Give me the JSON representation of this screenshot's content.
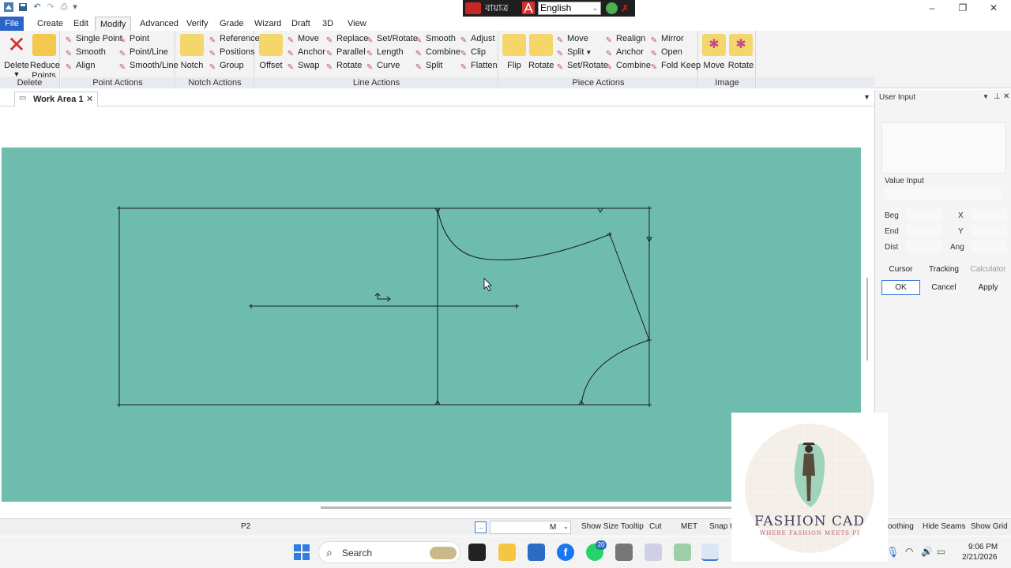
{
  "language": {
    "input_lang": "বায়াত্র",
    "selected": "English"
  },
  "menu": {
    "tabs": [
      {
        "label": "File"
      },
      {
        "label": "Create"
      },
      {
        "label": "Edit"
      },
      {
        "label": "Modify"
      },
      {
        "label": "Advanced"
      },
      {
        "label": "Verify"
      },
      {
        "label": "Grade"
      },
      {
        "label": "Wizard"
      },
      {
        "label": "Draft"
      },
      {
        "label": "3D"
      },
      {
        "label": "View"
      }
    ],
    "active": "Modify"
  },
  "ribbon": {
    "delete": {
      "label": "Delete",
      "buttons": [
        "Delete",
        "Reduce Points"
      ]
    },
    "point_actions": {
      "label": "Point Actions",
      "buttons": [
        "Single Point",
        "Point",
        "Smooth",
        "Point/Line",
        "Align",
        "Smooth/Line"
      ]
    },
    "notch_actions": {
      "label": "Notch Actions",
      "buttons": [
        "Notch",
        "Reference",
        "Positions",
        "Group"
      ]
    },
    "line_actions": {
      "label": "Line Actions",
      "buttons": [
        "Offset",
        "Move",
        "Anchor",
        "Swap",
        "Replace",
        "Parallel",
        "Rotate",
        "Set/Rotate",
        "Length",
        "Curve",
        "Smooth",
        "Combine",
        "Split",
        "Adjust",
        "Clip",
        "Flatten"
      ]
    },
    "piece_actions": {
      "label": "Piece Actions",
      "buttons": [
        "Flip",
        "Rotate",
        "Move",
        "Split",
        "Set/Rotate",
        "Realign",
        "Anchor",
        "Combine",
        "Mirror",
        "Open",
        "Fold Keep"
      ]
    },
    "image": {
      "label": "Image",
      "buttons": [
        "Move",
        "Rotate"
      ]
    }
  },
  "work_tab": {
    "label": "Work Area 1"
  },
  "user_input": {
    "title": "User Input",
    "value_input_label": "Value Input",
    "fields": {
      "beg": "Beg",
      "end": "End",
      "dist": "Dist",
      "x": "X",
      "y": "Y",
      "ang": "Ang"
    },
    "buttons": {
      "cursor": "Cursor",
      "tracking": "Tracking",
      "calculator": "Calculator",
      "ok": "OK",
      "cancel": "Cancel",
      "apply": "Apply"
    }
  },
  "status": {
    "piece": "P2",
    "dots": "...",
    "size_value": "M",
    "show_size_tooltip": "Show Size Tooltip",
    "cut": "Cut",
    "units": "MET",
    "snap": "Snap to",
    "smoothing": "oothing",
    "hide_seams": "Hide Seams",
    "show_grid": "Show Grid"
  },
  "taskbar": {
    "search": "Search",
    "badge": "20",
    "time": "9:06 PM",
    "date": "2/21/2026"
  },
  "logo": {
    "title": "FASHION CAD",
    "tagline": "WHERE FASHION MEETS PRECISION"
  },
  "colors": {
    "canvas": "#6ebcad",
    "accent": "#2b64c5",
    "ribbon": "#f3f3f3"
  }
}
